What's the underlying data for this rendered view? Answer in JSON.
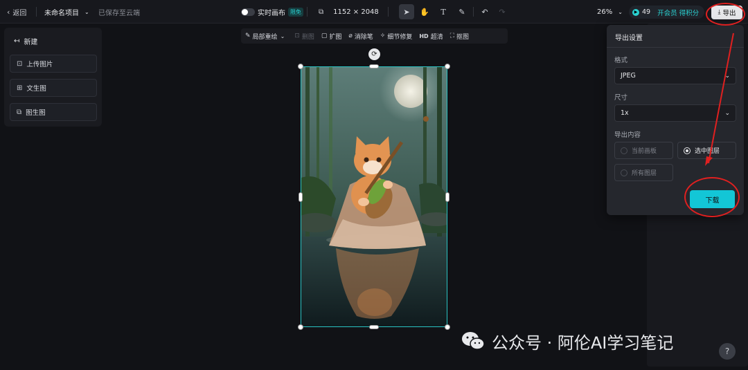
{
  "header": {
    "back_label": "返回",
    "project_name": "未命名项目",
    "save_status": "已保存至云端",
    "realtime_label": "实时画布",
    "realtime_badge": "限免",
    "canvas_size": "1152 × 2048",
    "zoom": "26%",
    "credits": "49",
    "vip_label": "开会员 得积分",
    "export_label": "导出"
  },
  "sidebar": {
    "new_label": "新建",
    "items": [
      {
        "label": "上传图片",
        "icon": "upload-image-icon"
      },
      {
        "label": "文生图",
        "icon": "text-to-image-icon"
      },
      {
        "label": "图生图",
        "icon": "image-to-image-icon"
      }
    ]
  },
  "context_toolbar": {
    "items": [
      {
        "label": "局部重绘",
        "enabled": true
      },
      {
        "label": "删图",
        "enabled": false
      },
      {
        "label": "扩图",
        "enabled": true
      },
      {
        "label": "消除笔",
        "enabled": true
      },
      {
        "label": "细节修复",
        "enabled": true
      },
      {
        "label": "超清",
        "prefix": "HD",
        "enabled": true
      },
      {
        "label": "抠图",
        "enabled": true
      }
    ]
  },
  "export_panel": {
    "title": "导出设置",
    "format_label": "格式",
    "format_value": "JPEG",
    "size_label": "尺寸",
    "size_value": "1x",
    "content_label": "导出内容",
    "options": [
      {
        "label": "当前画板",
        "selected": false
      },
      {
        "label": "选中图层",
        "selected": true
      },
      {
        "label": "所有图层",
        "selected": false
      }
    ],
    "download_label": "下载"
  },
  "watermark": {
    "text": "公众号 · 阿伦AI学习笔记"
  },
  "help_label": "?",
  "colors": {
    "accent": "#13c6d6",
    "selection": "#2ac5c5",
    "annotation": "#e02020"
  }
}
